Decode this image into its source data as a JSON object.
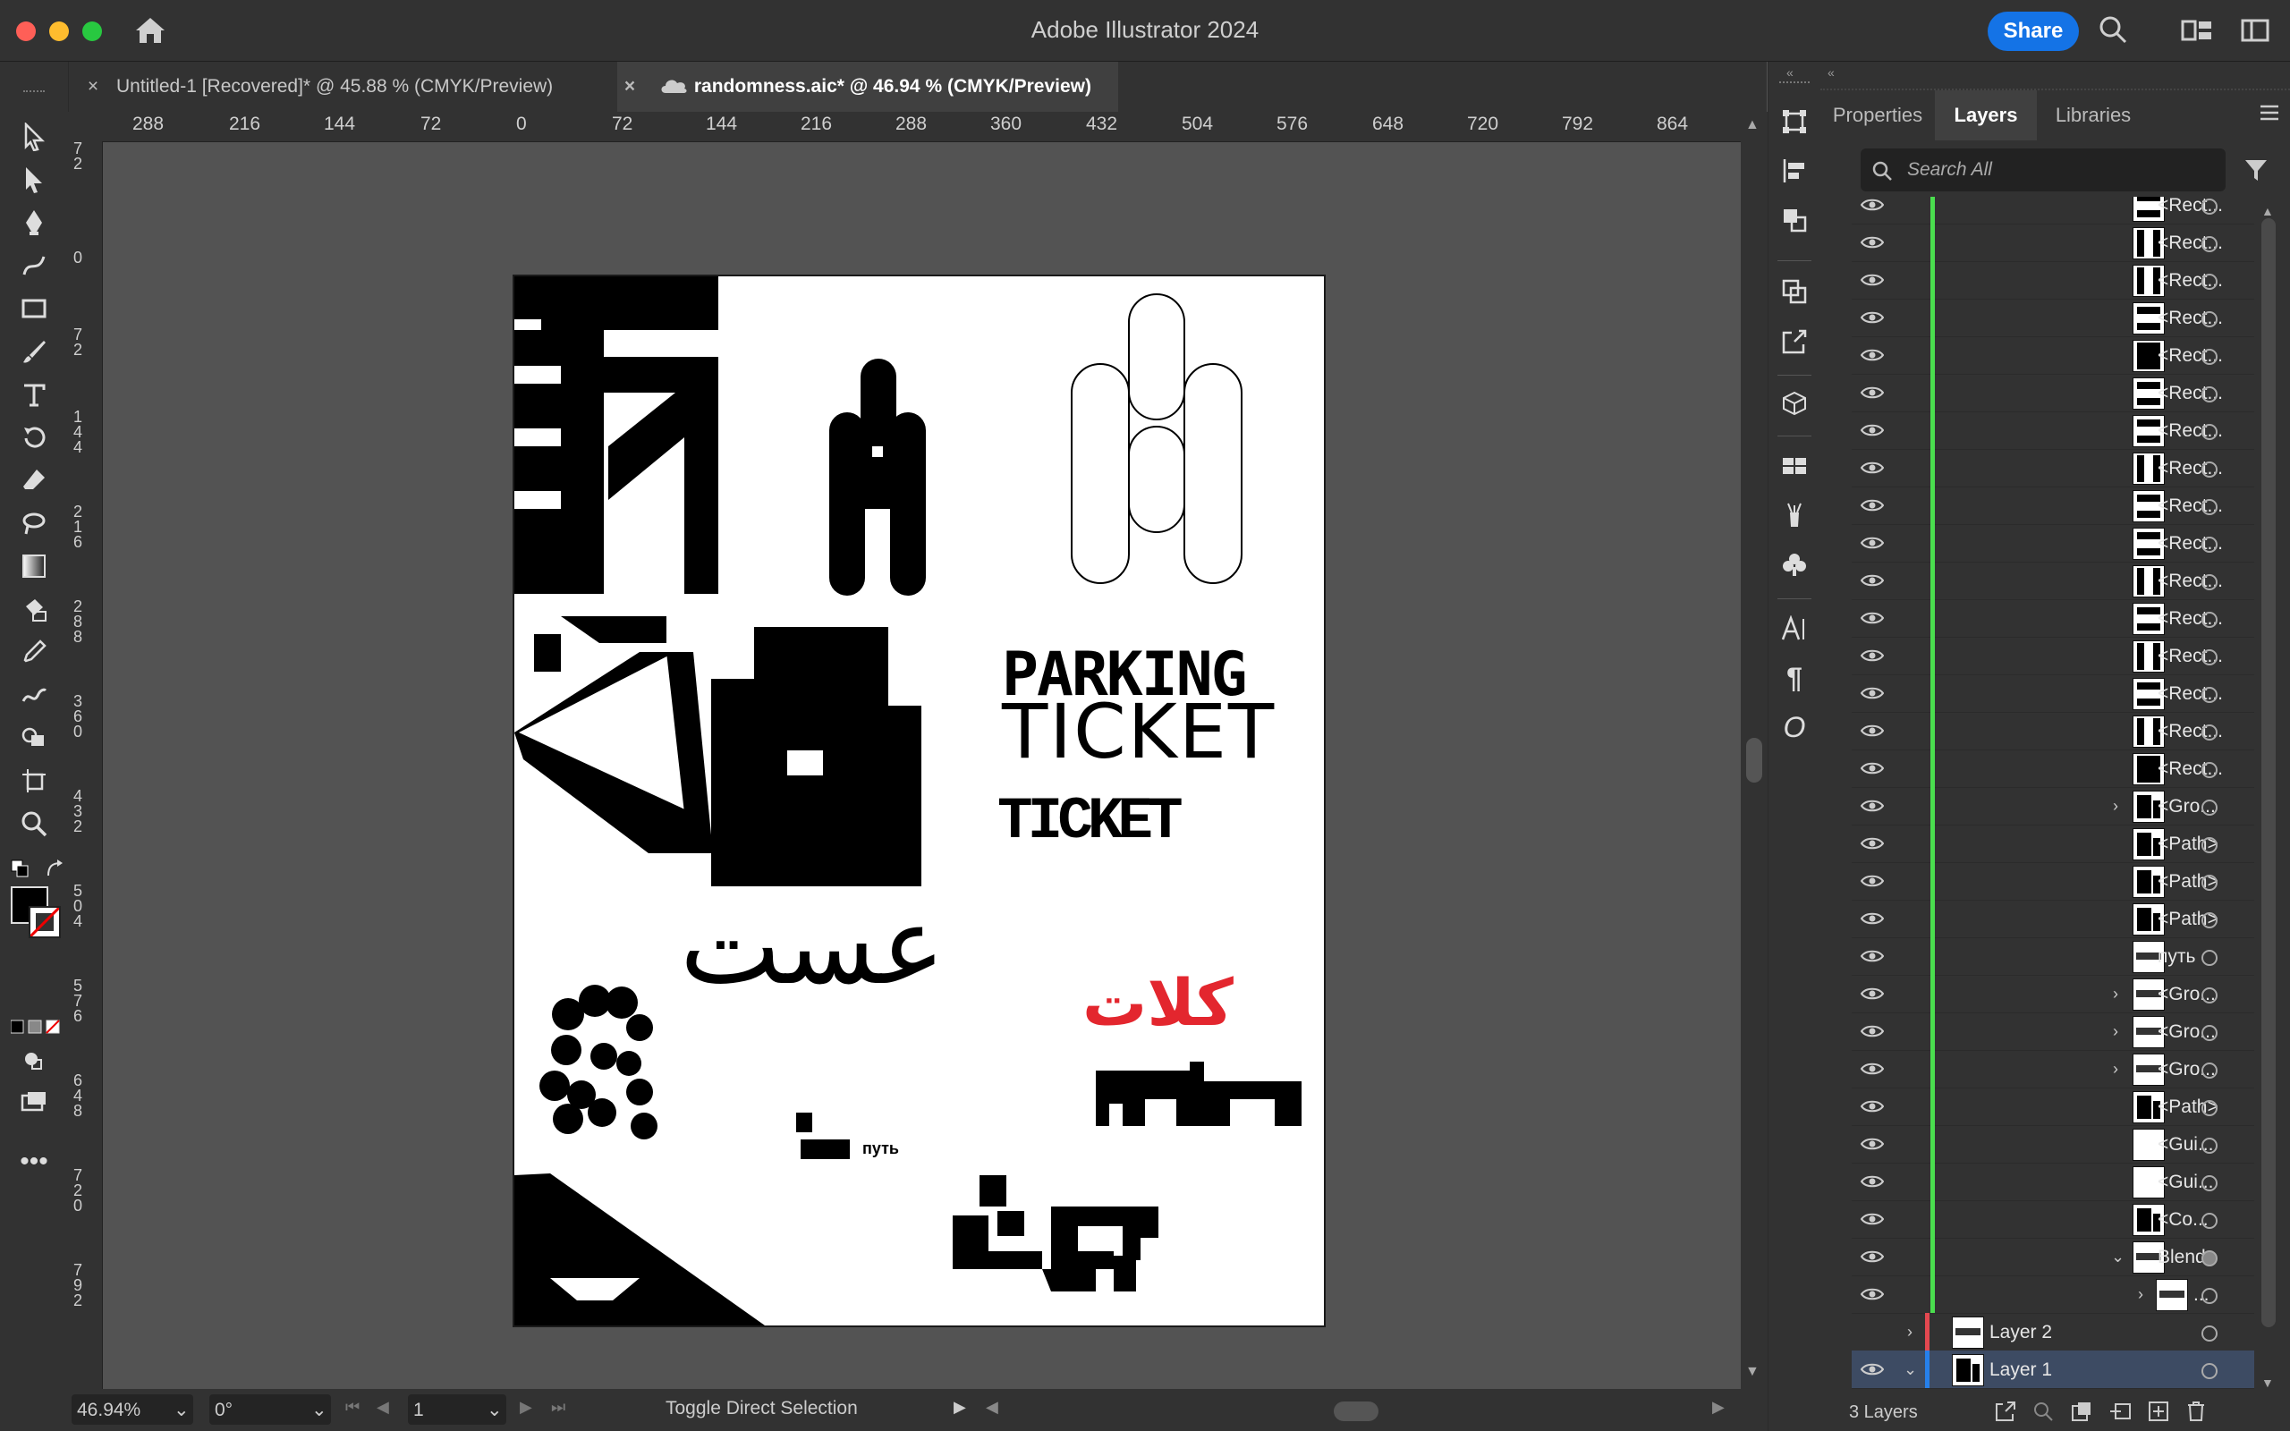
{
  "app": {
    "title": "Adobe Illustrator 2024",
    "share_label": "Share"
  },
  "colors": {
    "accent": "#1473e6",
    "layer1": "#2680eb",
    "layer2": "#e34850",
    "green": "#4ade4e",
    "ui_dark": "#323232"
  },
  "tabs": [
    {
      "label": "Untitled-1 [Recovered]* @ 45.88 % (CMYK/Preview)",
      "close": "×"
    },
    {
      "label": "randomness.aic* @ 46.94 % (CMYK/Preview)",
      "close": "×"
    }
  ],
  "ruler": {
    "h": [
      "288",
      "216",
      "144",
      "72",
      "0",
      "72",
      "144",
      "216",
      "288",
      "360",
      "432",
      "504",
      "576",
      "648",
      "720",
      "792",
      "864"
    ],
    "v": [
      "72",
      "0",
      "72",
      "144",
      "216",
      "288",
      "360",
      "432",
      "504",
      "576",
      "648",
      "720",
      "792"
    ]
  },
  "artboard": {
    "parking": "PARKING",
    "ticket": "TICKET",
    "ticket_small": "TICKET",
    "arabic": "عست",
    "red_text": "كلات",
    "put": "путь"
  },
  "status": {
    "zoom": "46.94%",
    "rotation": "0°",
    "artboard_num": "1",
    "tool_hint": "Toggle Direct Selection"
  },
  "panel": {
    "tabs": [
      "Properties",
      "Layers",
      "Libraries"
    ],
    "search_placeholder": "Search All",
    "footer": "3 Layers",
    "rows": [
      {
        "label": "<Rect...",
        "thumb": "h"
      },
      {
        "label": "<Rect...",
        "thumb": "v"
      },
      {
        "label": "<Rect...",
        "thumb": "v"
      },
      {
        "label": "<Rect...",
        "thumb": "h"
      },
      {
        "label": "<Rect...",
        "thumb": "black"
      },
      {
        "label": "<Rect...",
        "thumb": "h"
      },
      {
        "label": "<Rect...",
        "thumb": "h"
      },
      {
        "label": "<Rect...",
        "thumb": "v"
      },
      {
        "label": "<Rect...",
        "thumb": "h"
      },
      {
        "label": "<Rect...",
        "thumb": "h"
      },
      {
        "label": "<Rect...",
        "thumb": "v"
      },
      {
        "label": "<Rect...",
        "thumb": "h"
      },
      {
        "label": "<Rect...",
        "thumb": "v"
      },
      {
        "label": "<Rect...",
        "thumb": "h"
      },
      {
        "label": "<Rect...",
        "thumb": "v"
      },
      {
        "label": "<Rect...",
        "thumb": "black"
      },
      {
        "label": "<Gro...",
        "thumb": "shape",
        "expand": true
      },
      {
        "label": "<Path>",
        "thumb": "shape"
      },
      {
        "label": "<Path>",
        "thumb": "shape"
      },
      {
        "label": "<Path>",
        "thumb": "shape"
      },
      {
        "label": "путь",
        "thumb": "text"
      },
      {
        "label": "<Gro...",
        "thumb": "text",
        "expand": true
      },
      {
        "label": "<Gro...",
        "thumb": "text",
        "expand": true
      },
      {
        "label": "<Gro...",
        "thumb": "text",
        "expand": true
      },
      {
        "label": "<Path>",
        "thumb": "shape"
      },
      {
        "label": "<Gui...",
        "thumb": "white"
      },
      {
        "label": "<Gui...",
        "thumb": "white"
      },
      {
        "label": "<Co...",
        "thumb": "shape"
      },
      {
        "label": "Blend",
        "thumb": "text",
        "expanded": true
      },
      {
        "label": "...",
        "thumb": "text",
        "expand": true
      }
    ],
    "layer2": "Layer 2",
    "layer1": "Layer 1"
  }
}
